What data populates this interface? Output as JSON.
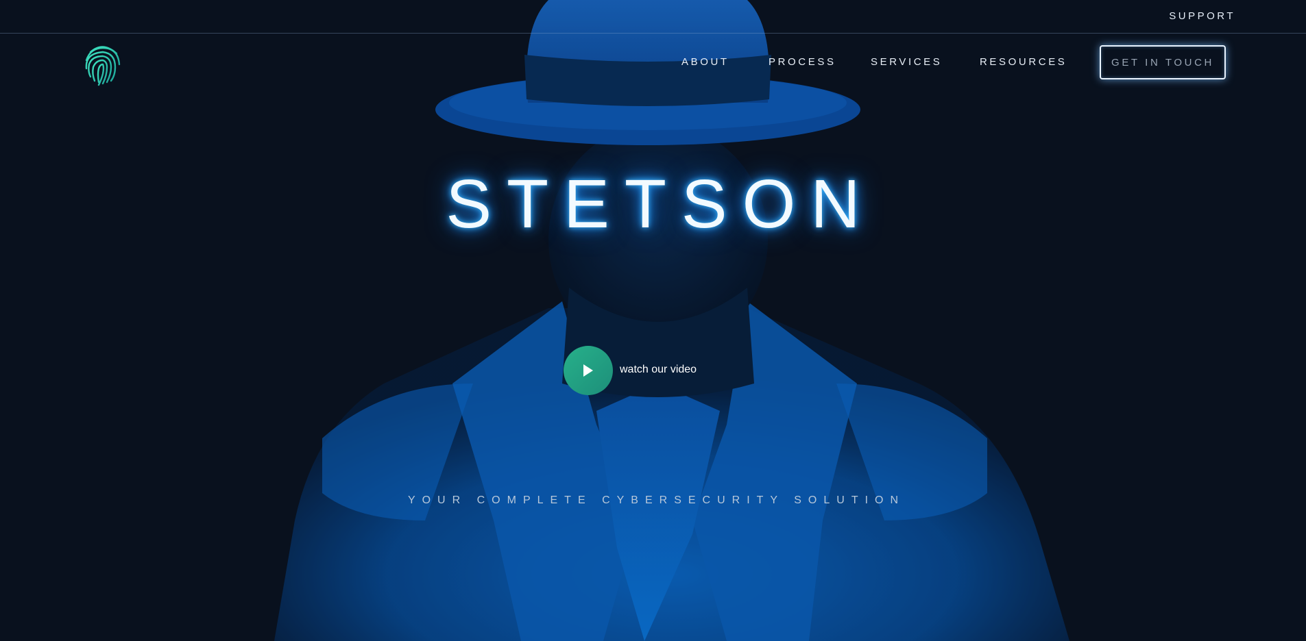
{
  "topbar": {
    "support_label": "SUPPORT"
  },
  "header": {
    "logo_icon": "fingerprint-icon",
    "nav": [
      {
        "label": "ABOUT"
      },
      {
        "label": "PROCESS"
      },
      {
        "label": "SERVICES"
      },
      {
        "label": "RESOURCES"
      }
    ],
    "cta_label": "GET IN TOUCH"
  },
  "hero": {
    "title": "STETSON",
    "video_icon": "play-icon",
    "video_label": "watch our video",
    "tagline": "YOUR COMPLETE CYBERSECURITY SOLUTION"
  },
  "colors": {
    "background": "#0a111e",
    "figure_blue": "#0a6fd6",
    "accent_green": "#27b08a",
    "title_glow": "#38b6ff"
  }
}
